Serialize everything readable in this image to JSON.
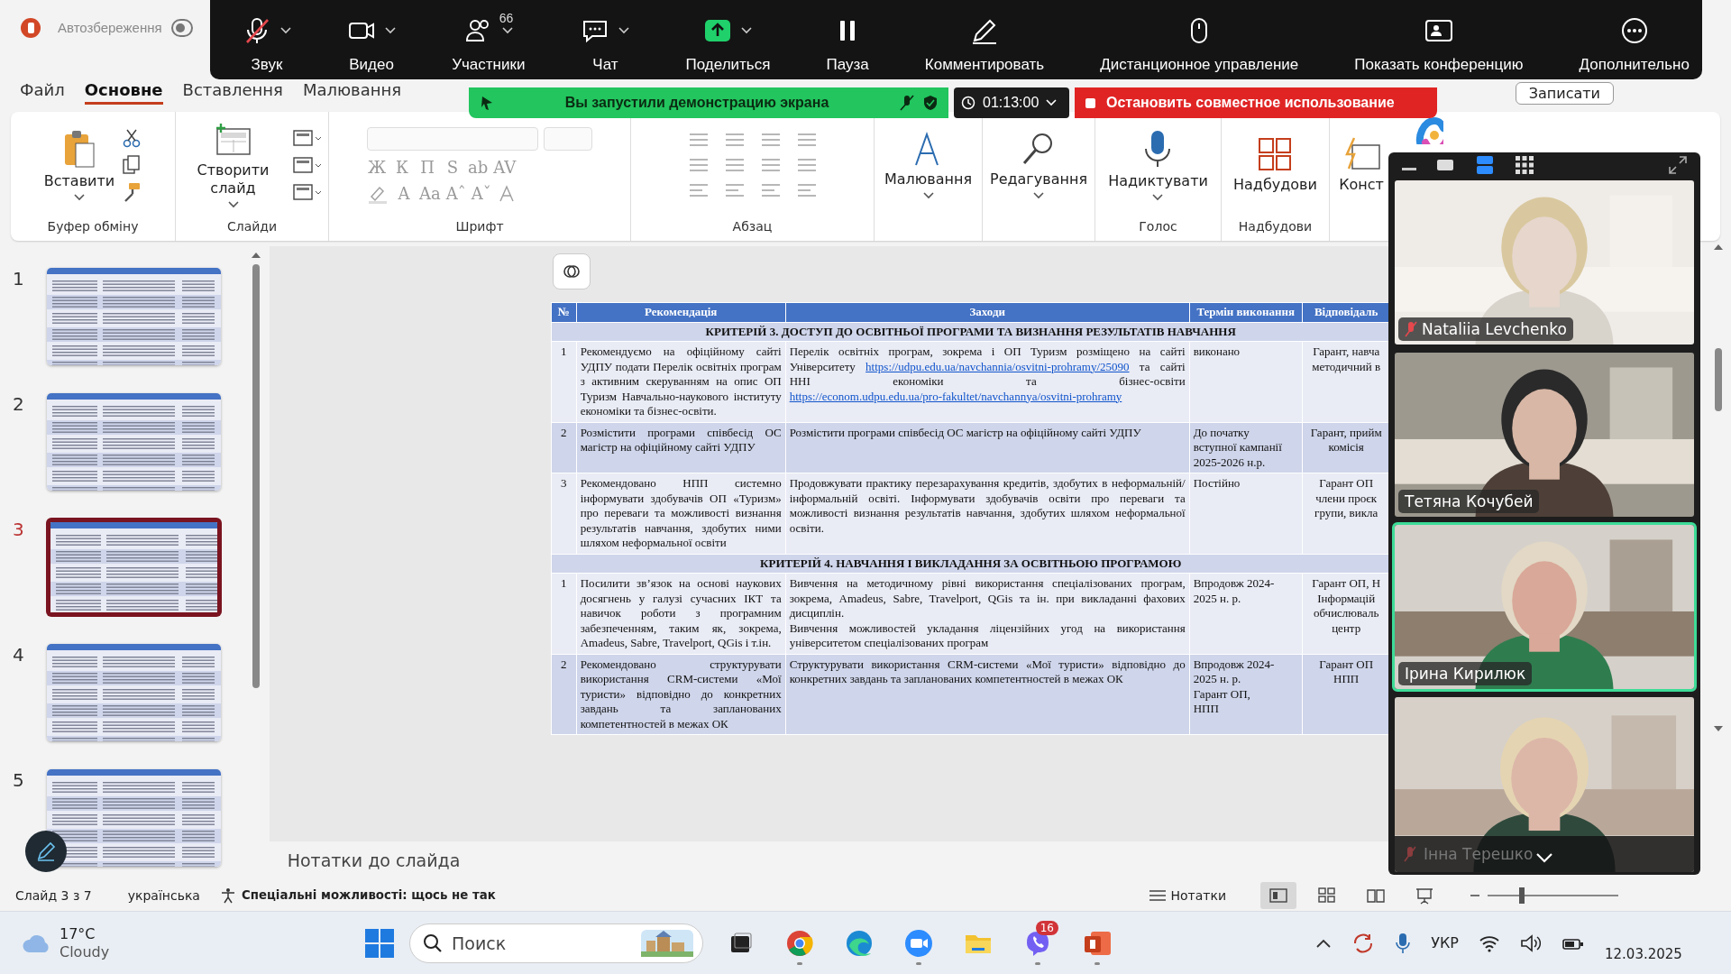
{
  "powerpoint": {
    "title_bar": {
      "autosave_label": "Автозбереження",
      "autosave_on": false
    },
    "tabs": [
      {
        "label": "Файл",
        "selected": false
      },
      {
        "label": "Основне",
        "selected": true
      },
      {
        "label": "Вставлення",
        "selected": false
      },
      {
        "label": "Малювання",
        "selected": false
      }
    ],
    "record_button": "Записати",
    "ribbon": [
      {
        "kind": "clipboard",
        "label": "Буфер обміну",
        "button": "Вставити"
      },
      {
        "kind": "slides",
        "label": "Слайди",
        "button": "Створити слайд"
      },
      {
        "kind": "font",
        "label": "Шрифт",
        "disabled": true,
        "glyphs": [
          "Ж",
          "К",
          "П",
          "S",
          "ab",
          "AV"
        ],
        "glyphs_2": [
          "A",
          "Aa",
          "Aˆ",
          "Aˇ"
        ]
      },
      {
        "kind": "paragraph",
        "label": "Абзац",
        "disabled": true
      },
      {
        "kind": "draw",
        "button": "Малювання"
      },
      {
        "kind": "edit",
        "button": "Редагування"
      },
      {
        "kind": "voice",
        "label": "Голос",
        "button": "Надиктувати"
      },
      {
        "kind": "addins",
        "label": "Надбудови",
        "button": "Надбудови"
      },
      {
        "kind": "designer",
        "button": "Конст"
      },
      {
        "kind": "copilot"
      }
    ],
    "slides": [
      {
        "number": "1",
        "selected": false
      },
      {
        "number": "2",
        "selected": false
      },
      {
        "number": "3",
        "selected": true
      },
      {
        "number": "4",
        "selected": false
      },
      {
        "number": "5",
        "selected": false
      }
    ],
    "slide": {
      "columns": [
        "№",
        "Рекомендація",
        "Заходи",
        "Термін виконання",
        "Відповідаль"
      ],
      "rows": [
        {
          "kind": "section",
          "text": "КРИТЕРІЙ 3. ДОСТУП ДО ОСВІТНЬОЇ ПРОГРАМИ ТА ВИЗНАННЯ РЕЗУЛЬТАТІВ НАВЧАННЯ"
        },
        {
          "kind": "item",
          "cells": [
            "1",
            "Рекомендуємо на офіційному сайті УДПУ подати Перелік освітніх програм з активним скеруванням на опис ОП Туризм Навчально-наукового інституту економіки та бізнес-освіти.",
            [
              {
                "kind": "text",
                "text": "Перелік освітніх програм, зокрема і ОП Туризм розміщено на сайті Університету"
              },
              {
                "kind": "link",
                "text": "https://udpu.edu.ua/navchannia/osvitni-prohramy/25090"
              },
              {
                "kind": "text",
                "text": "та сайті ННІ економіки та бізнес-освіти"
              },
              {
                "kind": "link",
                "text": "https://econom.udpu.edu.ua/pro-fakultet/navchannya/osvitni-prohramy"
              }
            ],
            "виконано",
            "Гарант, навча\nметодичний в"
          ]
        },
        {
          "kind": "item",
          "cells": [
            "2",
            "Розмістити програми співбесід ОС магістр на офіційному сайті УДПУ",
            "Розмістити програми співбесід ОС магістр на офіційному сайті УДПУ",
            "До початку\nвступної кампанії\n2025-2026 н.р.",
            "Гарант, прийм\nкомісія"
          ]
        },
        {
          "kind": "item",
          "cells": [
            "3",
            "Рекомендовано НПП системно інформувати здобувачів ОП «Туризм» про переваги та можливості визнання результатів навчання, здобутих ними шляхом неформальної освіти",
            "Продовжувати практику перезарахування кредитів, здобутих в неформальній/інформальній освіті. Інформувати здобувачів освіти про переваги та можливості визнання результатів навчання, здобутих шляхом неформальної освіти.",
            "Постійно",
            "Гарант ОП\nчлени проєк\nгрупи, викла"
          ]
        },
        {
          "kind": "section",
          "text": "КРИТЕРІЙ 4. НАВЧАННЯ І ВИКЛАДАННЯ ЗА ОСВІТНЬОЮ ПРОГРАМОЮ"
        },
        {
          "kind": "item",
          "cells": [
            "1",
            "Посилити зв’язок на основі наукових досягнень у галузі сучасних ІКТ та навичок роботи з програмним забезпеченням, таким як, зокрема, Amadeus, Sabre, Travelport, QGis і т.ін.",
            "Вивчення на методичному рівні використання спеціалізованих програм, зокрема, Amadeus, Sabre, Travelport, QGis та ін. при викладанні фахових дисциплін.\nВивчення можливостей укладання ліцензійних угод на використання університетом спеціалізованих програм",
            "Впродовж 2024-\n2025 н. р.",
            "Гарант ОП, Н\nІнформацій\nобчислюваль\nцентр"
          ]
        },
        {
          "kind": "item",
          "cells": [
            "2",
            "Рекомендовано структурувати використання CRM-системи «Мої туристи» відповідно до конкретних завдань та запланованих компетентностей в межах ОК",
            "Структурувати використання CRM-системи «Мої туристи» відповідно до конкретних завдань та запланованих компетентностей в межах ОК",
            "Впродовж 2024-\n2025 н. р.\nГарант ОП,\nНПП",
            "Гарант ОП\nНПП"
          ]
        }
      ]
    },
    "notes_placeholder": "Нотатки до слайда",
    "status_bar": {
      "slide": "Слайд 3 з 7",
      "language": "українська",
      "accessibility": "Спеціальні можливості: щось не так",
      "notes": "Нотатки",
      "views": [
        {
          "kind": "normal",
          "selected": true
        },
        {
          "kind": "sorter",
          "selected": false
        },
        {
          "kind": "reading",
          "selected": false
        },
        {
          "kind": "show",
          "selected": false
        }
      ],
      "zoom_slider": {
        "level": 0.26
      }
    }
  },
  "zoom": {
    "toolbar": [
      {
        "kind": "mic",
        "label": "Звук",
        "muted": true,
        "caret": true
      },
      {
        "kind": "video",
        "label": "Видео",
        "muted": false,
        "caret": true
      },
      {
        "kind": "participants",
        "label": "Участники",
        "count": "66",
        "muted": false,
        "caret": true
      },
      {
        "kind": "chat",
        "label": "Чат",
        "muted": false,
        "caret": true
      },
      {
        "kind": "share",
        "label": "Поделиться",
        "muted": false,
        "caret": true
      },
      {
        "kind": "pause",
        "label": "Пауза",
        "muted": false,
        "caret": false
      },
      {
        "kind": "annotate",
        "label": "Комментировать",
        "muted": false,
        "caret": false
      },
      {
        "kind": "remote",
        "label": "Дистанционное управление",
        "muted": false,
        "caret": false
      },
      {
        "kind": "show",
        "label": "Показать конференцию",
        "muted": false,
        "caret": false
      },
      {
        "kind": "more",
        "label": "Дополнительно",
        "muted": false,
        "caret": false
      }
    ],
    "share_bar": {
      "message": "Вы запустили демонстрацию экрана",
      "timer": "01:13:00",
      "stop": "Остановить совместное использование"
    },
    "view_modes": [
      {
        "kind": "single",
        "selected": false
      },
      {
        "kind": "stack",
        "selected": true
      },
      {
        "kind": "grid",
        "selected": false
      }
    ],
    "participants": [
      {
        "name": "Nataliia Levchenko",
        "muted": true,
        "active": false
      },
      {
        "name": "Тетяна Кочубей",
        "muted": false,
        "active": false
      },
      {
        "name": "Ірина Кирилюк",
        "muted": false,
        "active": true
      },
      {
        "name": "Інна Терешко",
        "muted": true,
        "active": false
      }
    ]
  },
  "taskbar": {
    "weather": {
      "temp": "17°C",
      "text": "Cloudy"
    },
    "search": {
      "placeholder": "Поиск"
    },
    "apps": [
      {
        "kind": "taskview",
        "running": false
      },
      {
        "kind": "chrome",
        "running": true
      },
      {
        "kind": "edge",
        "running": false
      },
      {
        "kind": "zoom",
        "running": true
      },
      {
        "kind": "files",
        "running": false
      },
      {
        "kind": "viber",
        "running": true,
        "badge": "16"
      },
      {
        "kind": "powerpoint",
        "running": true
      }
    ],
    "language": "УКР",
    "date": "12.03.2025"
  }
}
